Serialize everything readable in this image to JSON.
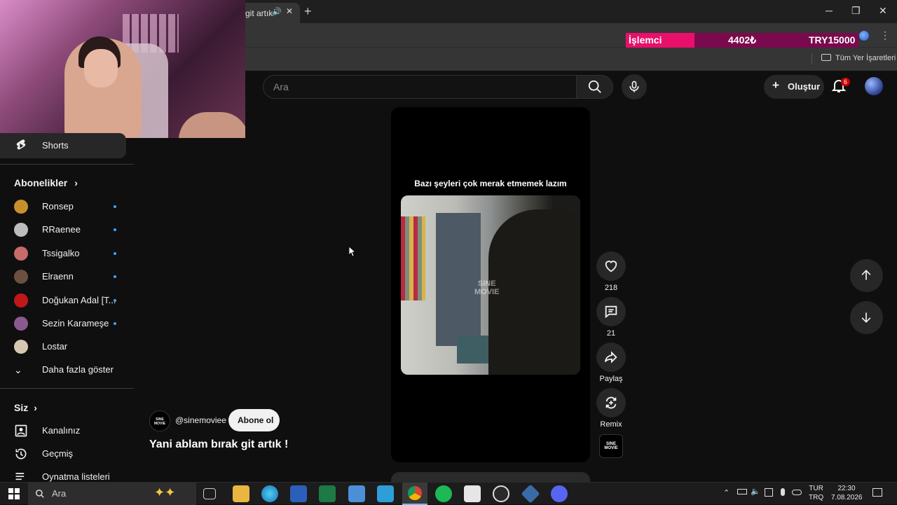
{
  "browser": {
    "tab_title": "git artık",
    "new_tab_label": "+",
    "tab_close": "✕",
    "window_controls": {
      "minimize": "─",
      "maximize": "❐",
      "close": "✕"
    },
    "bookmarks_all": "Tüm Yer İşaretleri",
    "menu_dots": "⋮"
  },
  "ticker": {
    "label": "İşlemci",
    "amount": "4402₺",
    "goal": "TRY15000"
  },
  "header": {
    "search_placeholder": "Ara",
    "create_label": "Oluştur",
    "notification_count": "6"
  },
  "sidebar": {
    "shorts_label": "Shorts",
    "subscriptions_heading": "Abonelikler",
    "subscriptions": [
      {
        "name": "Ronsep",
        "dot": true,
        "color": "#c8902a"
      },
      {
        "name": "RRaenee",
        "dot": true,
        "color": "#bdbdbd"
      },
      {
        "name": "Tssigalko",
        "dot": true,
        "color": "#c76a6a"
      },
      {
        "name": "Elraenn",
        "dot": true,
        "color": "#6b5040"
      },
      {
        "name": "Doğukan Adal [T...",
        "dot": true,
        "color": "#c01818"
      },
      {
        "name": "Sezin Karameşe",
        "dot": true,
        "color": "#8a5a8f"
      },
      {
        "name": "Lostar",
        "dot": false,
        "color": "#d8c7b0"
      }
    ],
    "show_more": "Daha fazla göster",
    "you_heading": "Siz",
    "you_items": [
      "Kanalınız",
      "Geçmiş",
      "Oynatma listeleri"
    ]
  },
  "short": {
    "caption": "Bazı şeyleri çok merak etmemek lazım",
    "watermark_line1": "SINE",
    "watermark_line2": "MOVIE",
    "likes": "218",
    "comments": "21",
    "share_label": "Paylaş",
    "remix_label": "Remix",
    "channel_handle": "@sinemoviee",
    "subscribe_label": "Abone ol",
    "title": "Yani ablam bırak git artık !",
    "channel_logo_line1": "SINE",
    "channel_logo_line2": "MOVIE"
  },
  "taskbar": {
    "search_placeholder": "Ara",
    "language_line1": "TUR",
    "language_line2": "TRQ",
    "time": "22:30",
    "date": "7.08.2026"
  }
}
